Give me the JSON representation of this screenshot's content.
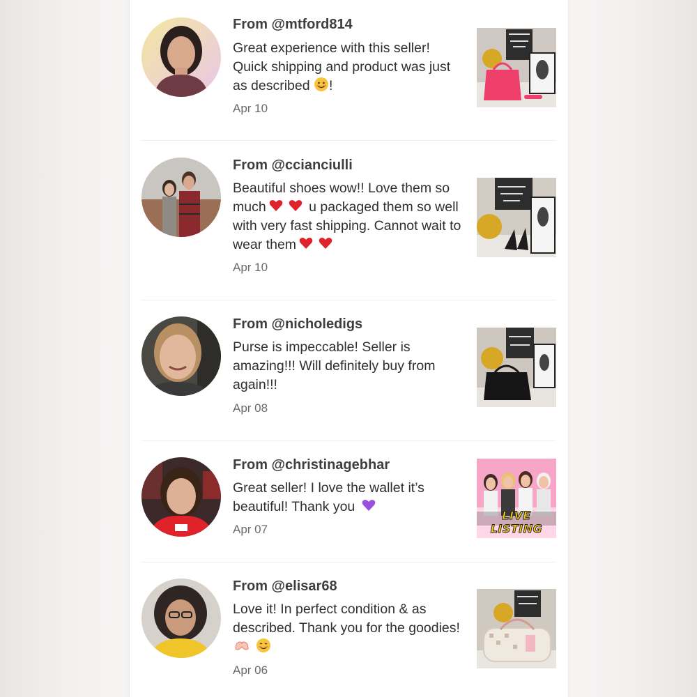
{
  "reviews": [
    {
      "from": "From @mtford814",
      "comment_parts": [
        "Great experience with this seller! Quick shipping and product was just as described ",
        "!"
      ],
      "emoji": [
        "smile-emoji"
      ],
      "date": "Apr 10",
      "thumbnail": "pink-handbag-photo"
    },
    {
      "from": "From @ccianciulli",
      "comment_parts": [
        "Beautiful shoes wow!! Love them so much",
        " u packaged them so well with very fast shipping. Cannot wait to wear them"
      ],
      "emoji": [
        "double-heart-emoji",
        "double-heart-emoji"
      ],
      "date": "Apr 10",
      "thumbnail": "black-shoes-photo"
    },
    {
      "from": "From @nicholedigs",
      "comment_parts": [
        "Purse is impeccable! Seller is amazing!!! Will definitely buy from again!!!"
      ],
      "emoji": [],
      "date": "Apr 08",
      "thumbnail": "black-purse-photo"
    },
    {
      "from": "From @christinagebhar",
      "comment_parts": [
        "Great seller! I love the wallet it’s beautiful! Thank you "
      ],
      "emoji": [
        "purple-heart-emoji"
      ],
      "date": "Apr 07",
      "thumbnail": "live-listing-graphic",
      "thumbnail_text": "LIVE LISTING"
    },
    {
      "from": "From @elisar68",
      "comment_parts": [
        "Love it! In perfect condition & as described. Thank you for the goodies! ",
        " "
      ],
      "emoji": [
        "heart-hands-emoji",
        "smiling-blush-emoji"
      ],
      "date": "Apr 06",
      "thumbnail": "white-duffel-bag-photo"
    }
  ],
  "colors": {
    "text_primary": "#2f2f2f",
    "username": "#3e3e3e",
    "date": "#6a6a6a",
    "divider": "#ececec"
  }
}
